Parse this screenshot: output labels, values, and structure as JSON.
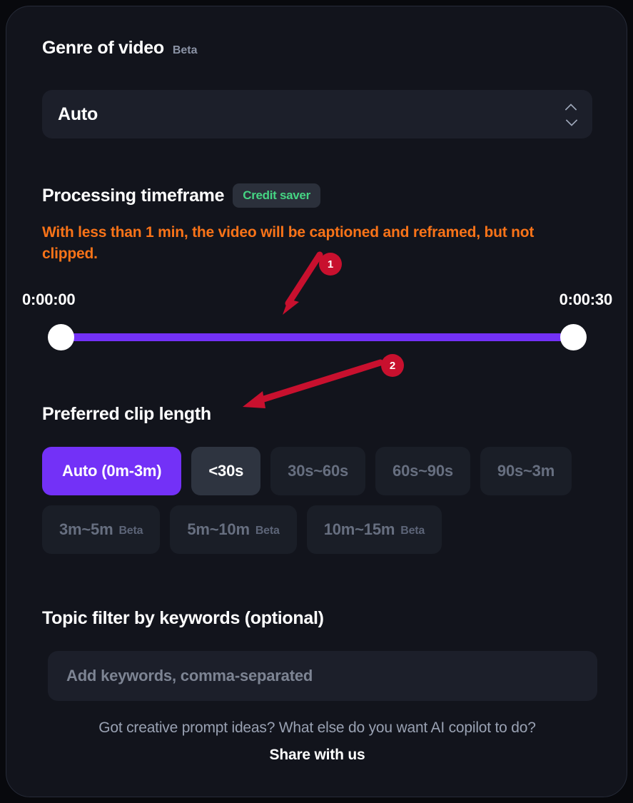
{
  "genre": {
    "heading": "Genre of video",
    "beta": "Beta",
    "selected_value": "Auto",
    "stepper_up_icon": "chevron-up-icon",
    "stepper_down_icon": "chevron-down-icon"
  },
  "timeframe": {
    "heading": "Processing timeframe",
    "badge": "Credit saver",
    "warning": "With less than 1 min, the video will be captioned and reframed, but not clipped.",
    "start_label": "0:00:00",
    "end_label": "0:00:30",
    "track_color": "#7331f7",
    "handle_color": "#ffffff"
  },
  "clip_length": {
    "heading": "Preferred clip length",
    "options": [
      {
        "label": "Auto (0m-3m)",
        "beta": "",
        "state": "selected"
      },
      {
        "label": "<30s",
        "beta": "",
        "state": "hovered"
      },
      {
        "label": "30s~60s",
        "beta": "",
        "state": "default"
      },
      {
        "label": "60s~90s",
        "beta": "",
        "state": "default"
      },
      {
        "label": "90s~3m",
        "beta": "",
        "state": "default"
      },
      {
        "label": "3m~5m",
        "beta": "Beta",
        "state": "default"
      },
      {
        "label": "5m~10m",
        "beta": "Beta",
        "state": "default"
      },
      {
        "label": "10m~15m",
        "beta": "Beta",
        "state": "default"
      }
    ],
    "selected_color": "#7331f7"
  },
  "keywords": {
    "heading": "Topic filter by keywords (optional)",
    "placeholder": "Add keywords, comma-separated",
    "value": ""
  },
  "footer": {
    "question": "Got creative prompt ideas? What else do you want AI copilot to do?",
    "link": "Share with us"
  },
  "annotations": {
    "color": "#c8102e",
    "markers": [
      {
        "id": "1",
        "label": "1"
      },
      {
        "id": "2",
        "label": "2"
      }
    ]
  }
}
